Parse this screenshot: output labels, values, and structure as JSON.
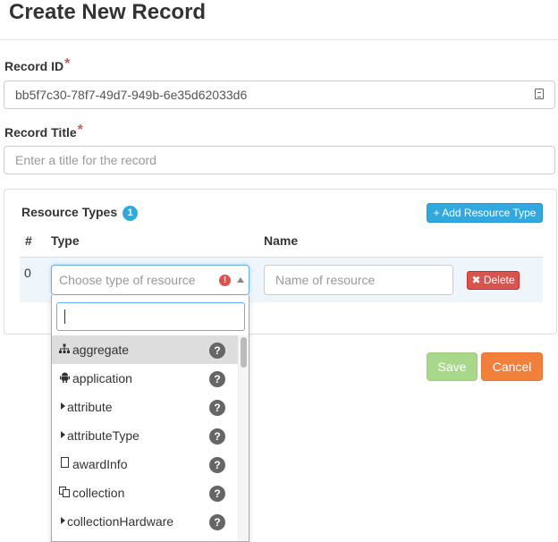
{
  "page": {
    "title": "Create New Record"
  },
  "record_id": {
    "label": "Record ID",
    "required_mark": "*",
    "value": "bb5f7c30-78f7-49d7-949b-6e35d62033d6",
    "icon": "id-card-icon"
  },
  "record_title": {
    "label": "Record Title",
    "required_mark": "*",
    "placeholder": "Enter a title for the record"
  },
  "resource_types": {
    "title": "Resource Types",
    "count": "1",
    "add_button": "+ Add Resource Type",
    "columns": {
      "num": "#",
      "type": "Type",
      "name": "Name"
    },
    "rows": [
      {
        "num": "0",
        "type_placeholder": "Choose type of resource",
        "name_placeholder": "Name of resource",
        "delete_label": "✖ Delete"
      }
    ]
  },
  "dropdown": {
    "search_value": "",
    "items": [
      {
        "label": "aggregate",
        "icon": "sitemap-icon",
        "help": "?"
      },
      {
        "label": "application",
        "icon": "android-icon",
        "help": "?"
      },
      {
        "label": "attribute",
        "icon": "caret-right-icon",
        "help": "?"
      },
      {
        "label": "attributeType",
        "icon": "caret-right-icon",
        "help": "?"
      },
      {
        "label": "awardInfo",
        "icon": "file-icon",
        "help": "?"
      },
      {
        "label": "collection",
        "icon": "copy-icon",
        "help": "?"
      },
      {
        "label": "collectionHardware",
        "icon": "caret-right-icon",
        "help": "?"
      }
    ]
  },
  "actions": {
    "save": "Save",
    "cancel": "Cancel"
  },
  "colors": {
    "primary": "#31a8e0",
    "danger": "#d9534f",
    "success_disabled": "#a9d88a",
    "warning": "#f0803c"
  }
}
